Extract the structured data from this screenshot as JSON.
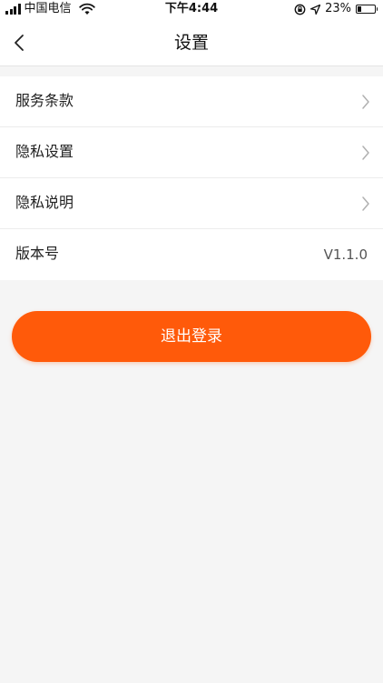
{
  "status_bar": {
    "carrier": "中国电信",
    "time": "下午4:44",
    "battery": "23%",
    "battery_level": 0.23
  },
  "nav": {
    "title": "设置"
  },
  "settings": {
    "items": [
      {
        "label": "服务条款",
        "has_chevron": true
      },
      {
        "label": "隐私设置",
        "has_chevron": true
      },
      {
        "label": "隐私说明",
        "has_chevron": true
      },
      {
        "label": "版本号",
        "value": "V1.1.0"
      }
    ]
  },
  "logout": {
    "label": "退出登录"
  },
  "colors": {
    "accent": "#ff5a0a",
    "background": "#f5f5f5",
    "surface": "#ffffff"
  }
}
